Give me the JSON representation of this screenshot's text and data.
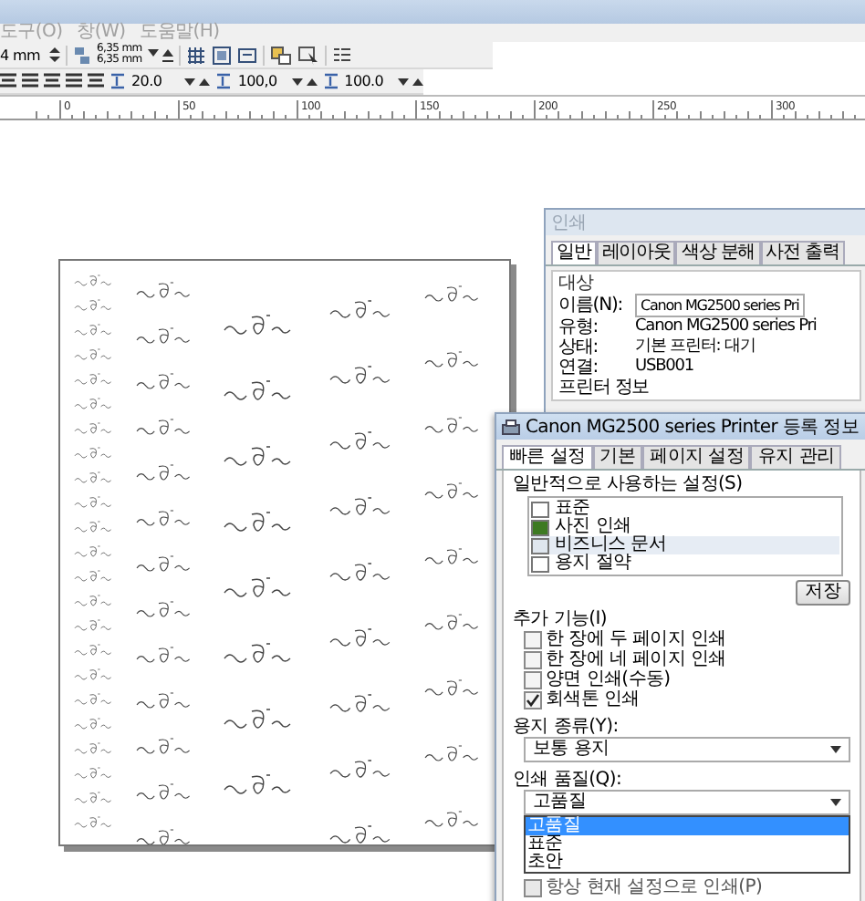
{
  "menu": [
    "도구(O)",
    "창(W)",
    "도움말(H)"
  ],
  "toolbar": {
    "size_value": "4 mm",
    "nudge_x": "6,35 mm",
    "nudge_y": "6,35 mm"
  },
  "text_toolbar": {
    "values": [
      "20.0",
      "100,0",
      "100.0"
    ]
  },
  "ruler": {
    "labels": [
      "0",
      "50",
      "100",
      "150",
      "200",
      "250",
      "300"
    ]
  },
  "print_dialog": {
    "title": "인쇄",
    "tabs": [
      {
        "label": "일반",
        "selected": true
      },
      {
        "label": "레이아웃",
        "selected": false
      },
      {
        "label": "색상 분해",
        "selected": false
      },
      {
        "label": "사전 출력",
        "selected": false
      }
    ],
    "group": "대상",
    "fields": [
      {
        "label": "이름(N):",
        "value": "Canon MG2500 series Pri",
        "kind": "combo"
      },
      {
        "label": "유형:",
        "value": "Canon MG2500 series Pri",
        "kind": "text"
      },
      {
        "label": "상태:",
        "value": "기본 프린터: 대기",
        "kind": "text"
      },
      {
        "label": "연결:",
        "value": "USB001",
        "kind": "text"
      }
    ],
    "info": "프린터 정보"
  },
  "properties_dialog": {
    "title": "Canon MG2500 series Printer 등록 정보",
    "tabs": [
      {
        "label": "빠른 설정",
        "selected": true
      },
      {
        "label": "기본",
        "selected": false
      },
      {
        "label": "페이지 설정",
        "selected": false
      },
      {
        "label": "유지 관리",
        "selected": false
      }
    ],
    "presets_label": "일반적으로 사용하는 설정(S)",
    "presets": [
      {
        "label": "표준",
        "selected": false
      },
      {
        "label": "사진 인쇄",
        "selected": false
      },
      {
        "label": "비즈니스 문서",
        "selected": true
      },
      {
        "label": "용지 절약",
        "selected": false
      }
    ],
    "save_button": "저장",
    "features_label": "추가 기능(I)",
    "features": [
      {
        "label": "한 장에 두 페이지 인쇄",
        "checked": false
      },
      {
        "label": "한 장에 네 페이지 인쇄",
        "checked": false
      },
      {
        "label": "양면 인쇄(수동)",
        "checked": false
      },
      {
        "label": "회색톤 인쇄",
        "checked": true
      }
    ],
    "media_label": "용지 종류(Y):",
    "media_value": "보통 용지",
    "quality_label": "인쇄 품질(Q):",
    "quality_value": "고품질",
    "quality_options": [
      {
        "label": "고품질",
        "selected": true
      },
      {
        "label": "표준",
        "selected": false
      },
      {
        "label": "초안",
        "selected": false
      }
    ],
    "always_print": {
      "label": "항상 현재 설정으로 인쇄(P)",
      "checked": false
    }
  }
}
